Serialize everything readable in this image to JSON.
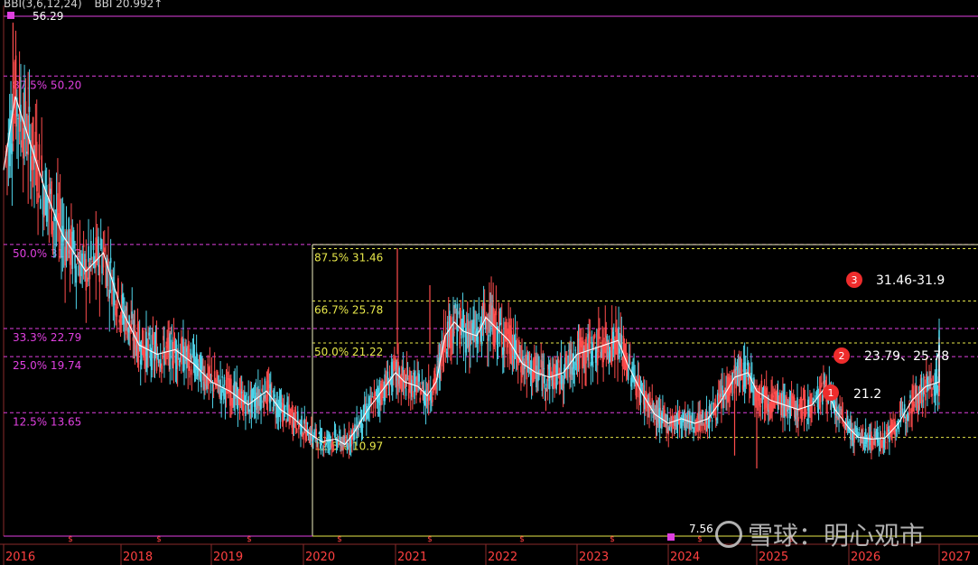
{
  "header": {
    "indicator": "BBI(3,6,12,24)",
    "value": "BBI 20.992↑"
  },
  "watermark": "雪球：明心观市",
  "colors": {
    "background": "#000000",
    "up": "#ff4d4d",
    "down": "#4fd3e8",
    "bbi": "#ffffff",
    "magenta": "#e040e0",
    "yellow": "#e8e84a",
    "axis_text": "#ff4040",
    "badge": "#ee2c2c"
  },
  "chart_data": {
    "type": "candlestick",
    "x_ticks": [
      "2016",
      "2018",
      "2019",
      "2020",
      "2021",
      "2022",
      "2023",
      "2024",
      "2025",
      "2026",
      "2027"
    ],
    "y_range": [
      7.0,
      57.0
    ],
    "high_marker": "56.29",
    "low_marker": "7.56",
    "magenta_levels": [
      {
        "label": "87.5% 50.20",
        "value": 50.2
      },
      {
        "label": "50.0% 31.92",
        "value": 31.92
      },
      {
        "label": "33.3% 22.79",
        "value": 22.79
      },
      {
        "label": "25.0% 19.74",
        "value": 19.74
      },
      {
        "label": "12.5% 13.65",
        "value": 13.65
      }
    ],
    "yellow_levels": [
      {
        "label": "87.5% 31.46",
        "value": 31.46
      },
      {
        "label": "66.7% 25.78",
        "value": 25.78
      },
      {
        "label": "50.0% 21.22",
        "value": 21.22
      },
      {
        "label": "12.5% 10.97",
        "value": 10.97
      }
    ],
    "callouts": [
      {
        "num": "3",
        "text": "31.46-31.9",
        "value": 31.9
      },
      {
        "num": "2",
        "text": "23.79、25.78",
        "value": 23.79
      },
      {
        "num": "1",
        "text": "21.2",
        "value": 21.2
      }
    ],
    "bbi_series": [
      [
        2016.0,
        40
      ],
      [
        2016.1,
        48
      ],
      [
        2016.2,
        44
      ],
      [
        2016.35,
        38
      ],
      [
        2016.5,
        33
      ],
      [
        2016.7,
        29
      ],
      [
        2016.85,
        31
      ],
      [
        2017.0,
        25
      ],
      [
        2017.2,
        21
      ],
      [
        2017.4,
        20
      ],
      [
        2017.6,
        20.5
      ],
      [
        2017.8,
        19
      ],
      [
        2018.0,
        17
      ],
      [
        2018.2,
        16
      ],
      [
        2018.4,
        14.5
      ],
      [
        2018.6,
        16
      ],
      [
        2018.75,
        14
      ],
      [
        2018.9,
        13
      ],
      [
        2019.05,
        11.5
      ],
      [
        2019.2,
        10.5
      ],
      [
        2019.35,
        10.8
      ],
      [
        2019.45,
        10.2
      ],
      [
        2019.55,
        11.5
      ],
      [
        2019.7,
        14
      ],
      [
        2019.85,
        16
      ],
      [
        2020.0,
        18
      ],
      [
        2020.1,
        17
      ],
      [
        2020.25,
        16.5
      ],
      [
        2020.35,
        15.5
      ],
      [
        2020.45,
        17
      ],
      [
        2020.55,
        22
      ],
      [
        2020.65,
        23.5
      ],
      [
        2020.75,
        22.5
      ],
      [
        2020.9,
        22
      ],
      [
        2021.0,
        24
      ],
      [
        2021.1,
        23
      ],
      [
        2021.25,
        21.5
      ],
      [
        2021.4,
        19
      ],
      [
        2021.55,
        18
      ],
      [
        2021.7,
        17.5
      ],
      [
        2021.85,
        18
      ],
      [
        2022.0,
        20
      ],
      [
        2022.15,
        20.5
      ],
      [
        2022.3,
        21
      ],
      [
        2022.45,
        21.5
      ],
      [
        2022.55,
        19
      ],
      [
        2022.7,
        16
      ],
      [
        2022.85,
        13.5
      ],
      [
        2023.0,
        12.5
      ],
      [
        2023.15,
        13
      ],
      [
        2023.3,
        12.5
      ],
      [
        2023.45,
        13
      ],
      [
        2023.6,
        15
      ],
      [
        2023.75,
        17.5
      ],
      [
        2023.9,
        18
      ],
      [
        2024.0,
        16
      ],
      [
        2024.15,
        15
      ],
      [
        2024.3,
        14.5
      ],
      [
        2024.45,
        14
      ],
      [
        2024.6,
        14.5
      ],
      [
        2024.75,
        16.5
      ],
      [
        2024.85,
        14
      ],
      [
        2025.0,
        12
      ],
      [
        2025.1,
        11
      ],
      [
        2025.25,
        10.8
      ],
      [
        2025.4,
        10.9
      ],
      [
        2025.55,
        12.5
      ],
      [
        2025.7,
        15
      ],
      [
        2025.85,
        16.5
      ],
      [
        2026.0,
        17
      ],
      [
        2026.1,
        17.5
      ],
      [
        2026.25,
        18.5
      ],
      [
        2026.4,
        18
      ],
      [
        2026.55,
        19
      ],
      [
        2026.7,
        20.5
      ],
      [
        2026.85,
        21
      ]
    ]
  }
}
